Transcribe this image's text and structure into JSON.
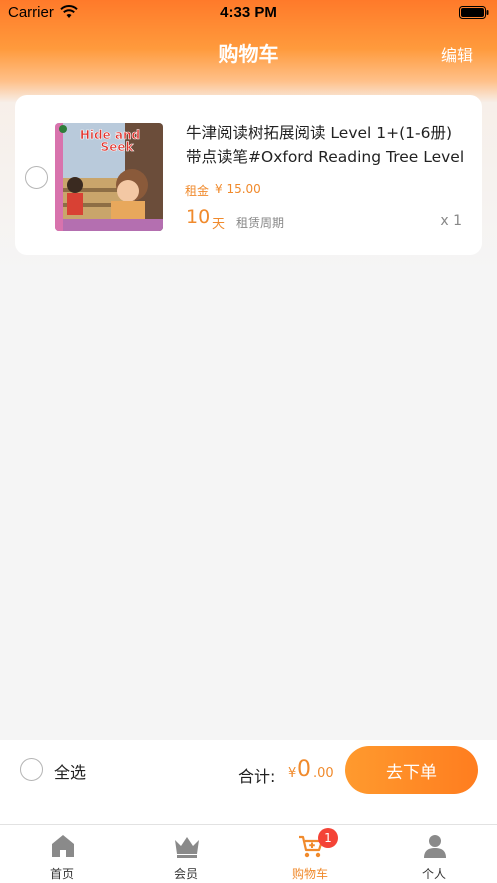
{
  "status_bar": {
    "carrier": "Carrier",
    "time": "4:33 PM"
  },
  "nav": {
    "title": "购物车",
    "edit_label": "编辑"
  },
  "cart_item": {
    "title_line1": "牛津阅读树拓展阅读 Level 1+(1-6册)",
    "title_line2": "带点读笔#Oxford Reading Tree Level",
    "cover_text_line1": "Hide and",
    "cover_text_line2": "Seek",
    "rent_label": "租金",
    "rent_price": "¥ 15.00",
    "days": "10",
    "days_unit": "天",
    "period_label": "租赁周期",
    "quantity": "x 1"
  },
  "bottom_bar": {
    "select_all_label": "全选",
    "total_label": "合计:",
    "currency": "¥",
    "total_int": "0",
    "total_dec": ".00",
    "order_button_label": "去下单"
  },
  "tabs": [
    {
      "label": "首页",
      "icon": "home-icon"
    },
    {
      "label": "会员",
      "icon": "crown-icon"
    },
    {
      "label": "购物车",
      "icon": "cart-icon",
      "badge": "1"
    },
    {
      "label": "个人",
      "icon": "person-icon"
    }
  ],
  "colors": {
    "accent": "#f08a2c",
    "header_top": "#ff7a2a",
    "badge": "#f44336"
  }
}
